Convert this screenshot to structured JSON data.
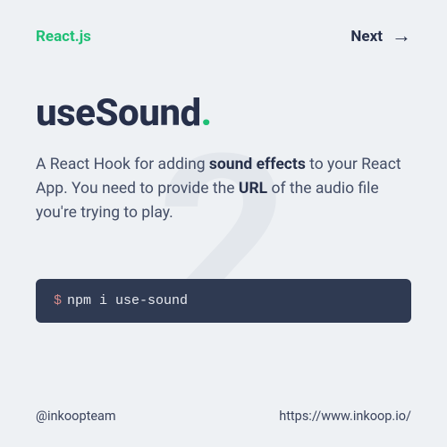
{
  "header": {
    "brand": "React.js",
    "next_label": "Next"
  },
  "ghost_number": "2",
  "title": {
    "text": "useSound",
    "dot": "."
  },
  "description": {
    "part1": "A React Hook for adding ",
    "bold1": "sound effects",
    "part2": " to your React App. You need to provide the ",
    "bold2": "URL",
    "part3": " of the audio file you're trying to play."
  },
  "terminal": {
    "prompt": "$",
    "command": "npm i use-sound"
  },
  "footer": {
    "handle": "@inkoopteam",
    "url": "https://www.inkoop.io/"
  }
}
